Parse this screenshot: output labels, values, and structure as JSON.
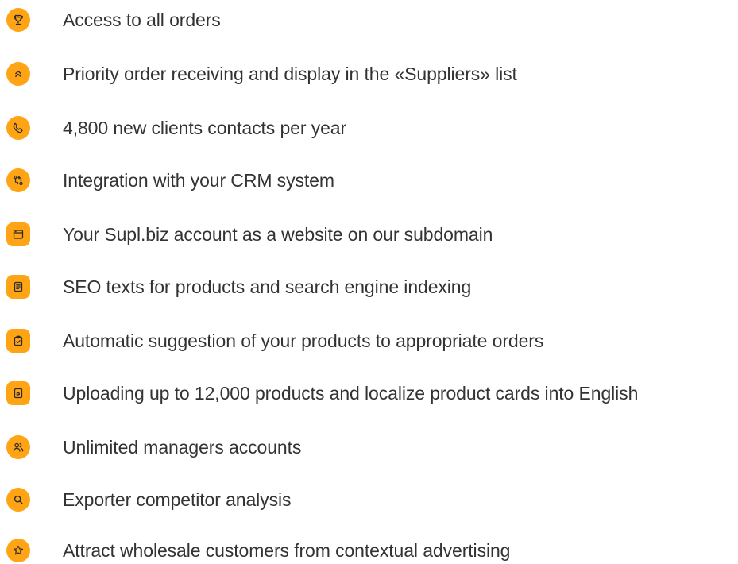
{
  "colors": {
    "accent": "#FFA414",
    "icon_stroke": "#2b2b2b",
    "text": "#333333",
    "background": "#ffffff"
  },
  "features": [
    {
      "icon": "trophy-icon",
      "label": "Access to all orders"
    },
    {
      "icon": "double-chevron-up-icon",
      "label": "Priority order receiving and display in the «Suppliers» list"
    },
    {
      "icon": "phone-icon",
      "label": "4,800 new clients contacts per year"
    },
    {
      "icon": "sync-arrows-icon",
      "label": "Integration with your CRM system"
    },
    {
      "icon": "browser-window-icon",
      "label": "Your Supl.biz account as a website on our subdomain"
    },
    {
      "icon": "document-text-icon",
      "label": "SEO texts for products and search engine indexing"
    },
    {
      "icon": "clipboard-check-icon",
      "label": "Automatic suggestion of your products to appropriate orders"
    },
    {
      "icon": "product-card-icon",
      "label": "Uploading up to 12,000 products and localize product cards into English"
    },
    {
      "icon": "users-icon",
      "label": "Unlimited managers accounts"
    },
    {
      "icon": "search-icon",
      "label": "Exporter competitor analysis"
    },
    {
      "icon": "star-icon",
      "label": "Attract wholesale customers from contextual advertising"
    }
  ]
}
